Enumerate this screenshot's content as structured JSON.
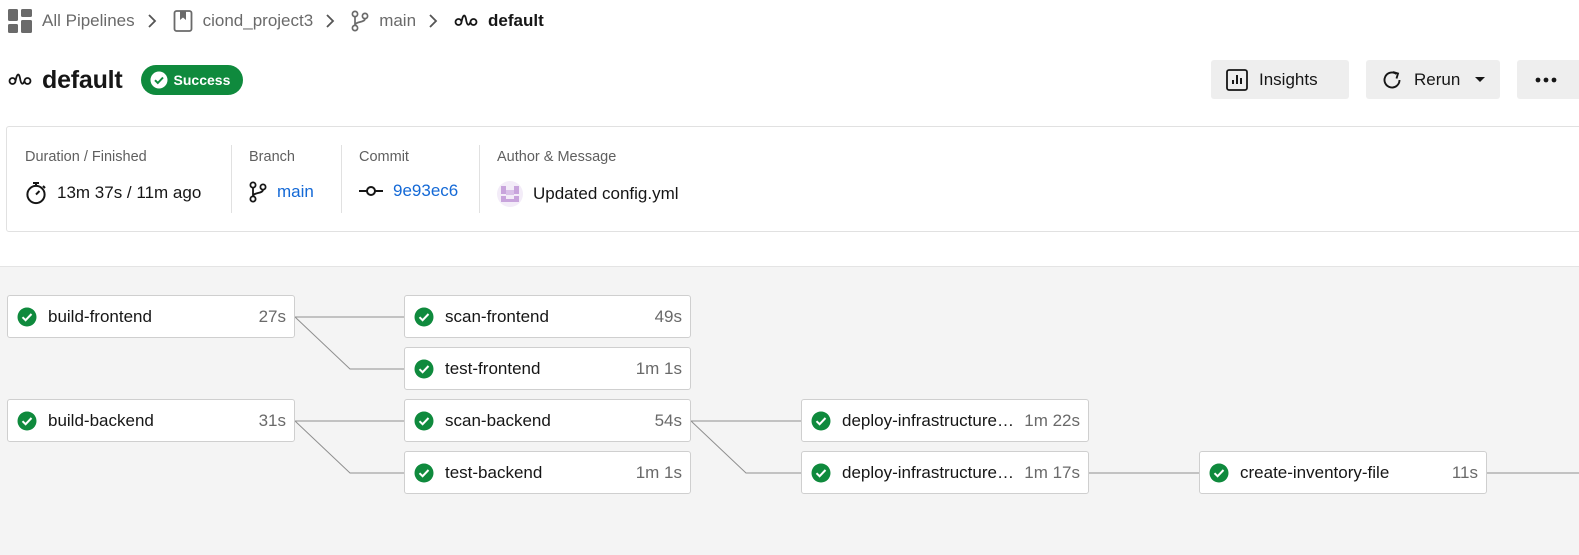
{
  "breadcrumb": {
    "all_pipelines": "All Pipelines",
    "project": "ciond_project3",
    "branch": "main",
    "workflow": "default"
  },
  "header": {
    "title": "default",
    "status": "Success",
    "status_color": "#0f8a3d"
  },
  "actions": {
    "insights": "Insights",
    "rerun": "Rerun",
    "more": "more-options"
  },
  "info": {
    "duration_label": "Duration / Finished",
    "duration_value": "13m 37s / 11m ago",
    "branch_label": "Branch",
    "branch_value": "main",
    "commit_label": "Commit",
    "commit_value": "9e93ec6",
    "author_label": "Author & Message",
    "message": "Updated config.yml"
  },
  "jobs": [
    {
      "name": "build-frontend",
      "duration": "27s",
      "status": "success"
    },
    {
      "name": "scan-frontend",
      "duration": "49s",
      "status": "success"
    },
    {
      "name": "test-frontend",
      "duration": "1m 1s",
      "status": "success"
    },
    {
      "name": "build-backend",
      "duration": "31s",
      "status": "success"
    },
    {
      "name": "scan-backend",
      "duration": "54s",
      "status": "success"
    },
    {
      "name": "test-backend",
      "duration": "1m 1s",
      "status": "success"
    },
    {
      "name": "deploy-infrastructure-…",
      "duration": "1m 22s",
      "status": "success"
    },
    {
      "name": "deploy-infrastructure-…",
      "duration": "1m 17s",
      "status": "success"
    },
    {
      "name": "create-inventory-file",
      "duration": "11s",
      "status": "success"
    }
  ],
  "colors": {
    "success": "#0f8a3d",
    "link": "#1469d6",
    "graph_background": "#f4f4f4"
  }
}
